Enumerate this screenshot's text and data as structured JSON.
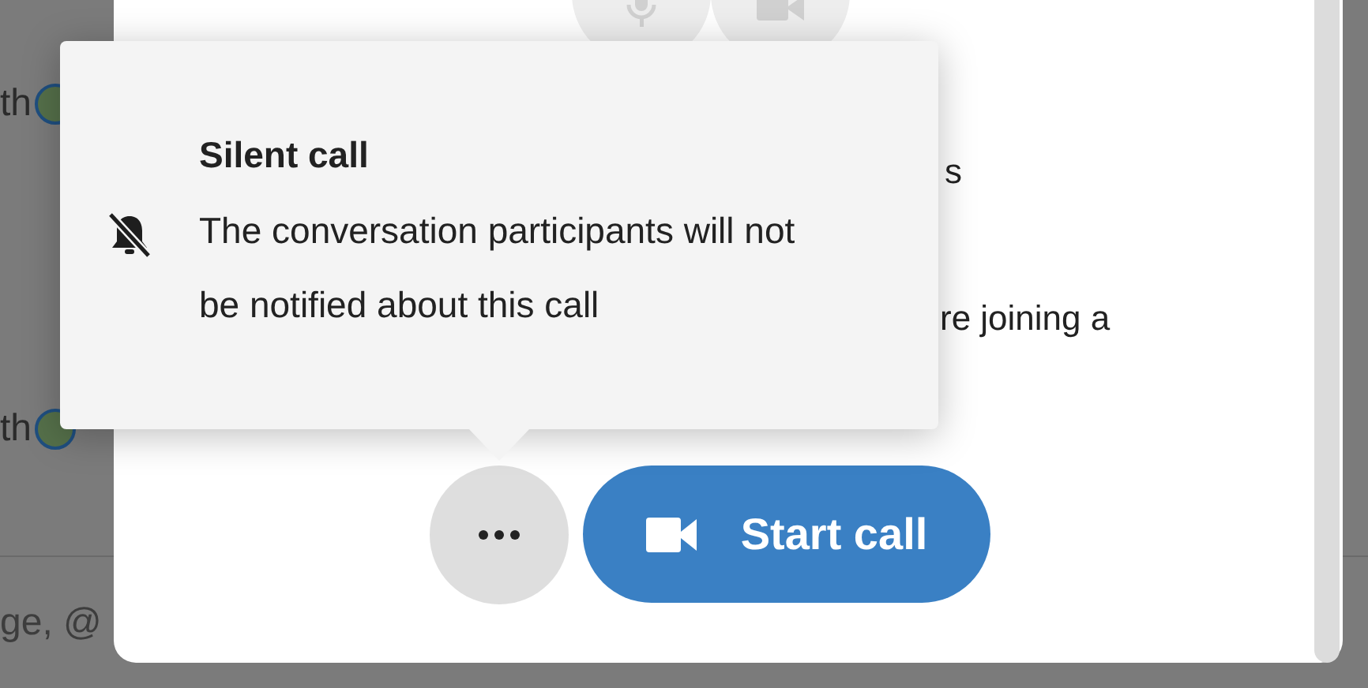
{
  "background": {
    "messages": [
      {
        "text": "th"
      },
      {
        "text": "th"
      }
    ],
    "composer": {
      "placeholder": "ge, @"
    }
  },
  "dialog": {
    "text_fragments": [
      "s",
      "re joining a"
    ],
    "start_button": {
      "label": "Start call"
    }
  },
  "popover": {
    "title": "Silent call",
    "description": "The conversation participants will not be notified about this call"
  }
}
